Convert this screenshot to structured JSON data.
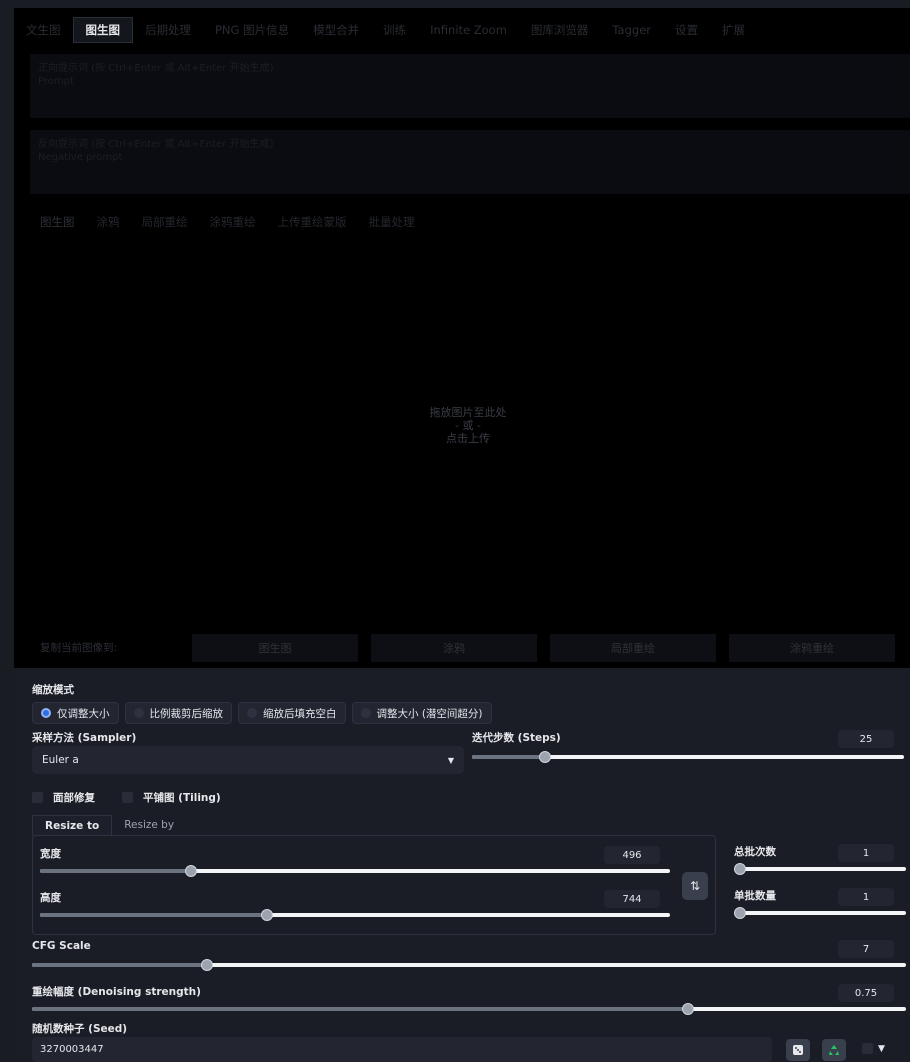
{
  "main_tabs": [
    "文生图",
    "图生图",
    "后期处理",
    "PNG 图片信息",
    "模型合并",
    "训练",
    "Infinite Zoom",
    "图库浏览器",
    "Tagger",
    "设置",
    "扩展"
  ],
  "prompt": {
    "placeholder": "正向提示词 (按 Ctrl+Enter 或 Alt+Enter 开始生成)",
    "hint": "Prompt"
  },
  "negative_prompt": {
    "placeholder": "反向提示词 (按 Ctrl+Enter 或 Alt+Enter 开始生成)",
    "hint": "Negative prompt"
  },
  "sub_tabs": [
    "图生图",
    "涂鸦",
    "局部重绘",
    "涂鸦重绘",
    "上传重绘蒙版",
    "批量处理"
  ],
  "drop_area": {
    "line1": "拖放图片至此处",
    "line2": "- 或 -",
    "line3": "点击上传"
  },
  "copy_to": {
    "label": "复制当前图像到:",
    "buttons": [
      "图生图",
      "涂鸦",
      "局部重绘",
      "涂鸦重绘"
    ]
  },
  "resize_mode": {
    "label": "缩放模式",
    "options": [
      "仅调整大小",
      "比例裁剪后缩放",
      "缩放后填充空白",
      "调整大小 (潜空间超分)"
    ],
    "selected_index": 0
  },
  "sampler": {
    "label": "采样方法 (Sampler)",
    "value": "Euler a"
  },
  "steps": {
    "label": "迭代步数 (Steps)",
    "value": "25",
    "fraction": 0.17
  },
  "checkboxes": {
    "face_restore": "面部修复",
    "tiling": "平铺图 (Tiling)"
  },
  "resize_tabs": [
    "Resize to",
    "Resize by"
  ],
  "width": {
    "label": "宽度",
    "value": "496",
    "fraction": 0.24
  },
  "height": {
    "label": "高度",
    "value": "744",
    "fraction": 0.36
  },
  "swap_icon": "⇅",
  "batch_count": {
    "label": "总批次数",
    "value": "1",
    "fraction": 0.0
  },
  "batch_size": {
    "label": "单批数量",
    "value": "1",
    "fraction": 0.0
  },
  "cfg": {
    "label": "CFG Scale",
    "value": "7",
    "fraction": 0.2
  },
  "denoise": {
    "label": "重绘幅度 (Denoising strength)",
    "value": "0.75",
    "fraction": 0.75
  },
  "seed": {
    "label": "随机数种子 (Seed)",
    "value": "3270003447"
  },
  "icons": {
    "dice": "dice-icon",
    "recycle": "recycle-icon"
  },
  "extra_arrow": "▼"
}
